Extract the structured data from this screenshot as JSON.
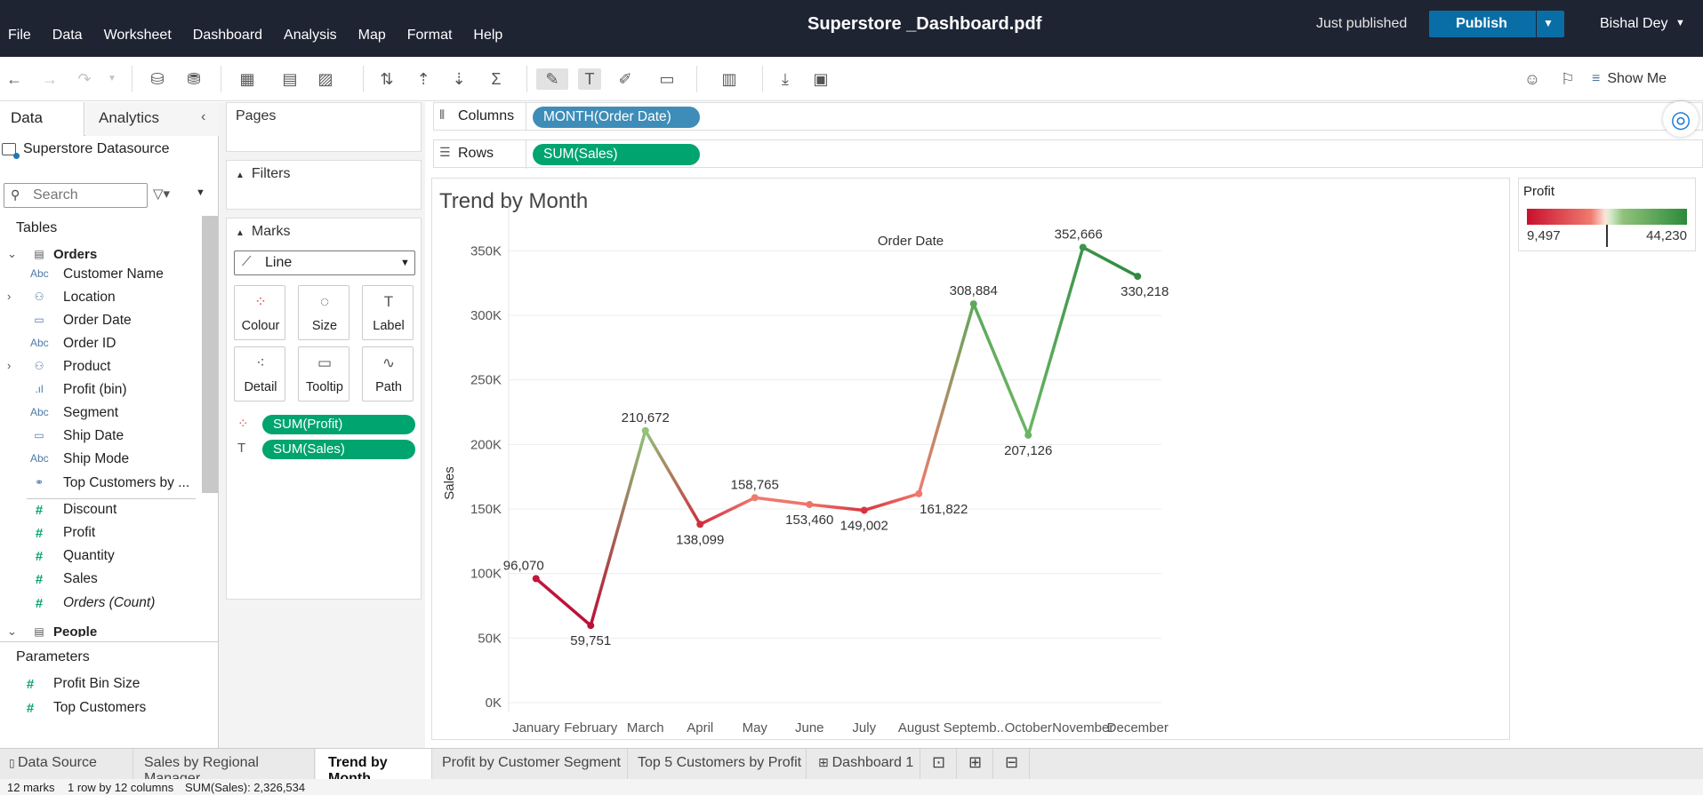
{
  "menu": [
    "File",
    "Data",
    "Worksheet",
    "Dashboard",
    "Analysis",
    "Map",
    "Format",
    "Help"
  ],
  "window_title": "Superstore _Dashboard.pdf",
  "publish_status": "Just published",
  "publish_label": "Publish",
  "user_name": "Bishal Dey",
  "show_me_label": "Show Me",
  "data_pane": {
    "tab_data": "Data",
    "tab_analytics": "Analytics",
    "datasource": "Superstore Datasource",
    "search_placeholder": "Search",
    "tables_heading": "Tables",
    "table_name": "Orders",
    "dimensions": [
      {
        "name": "Customer Name",
        "icon": "Abc"
      },
      {
        "name": "Location",
        "icon": "hierarchy-icon"
      },
      {
        "name": "Order Date",
        "icon": "calendar-icon"
      },
      {
        "name": "Order ID",
        "icon": "Abc"
      },
      {
        "name": "Product",
        "icon": "hierarchy-icon"
      },
      {
        "name": "Profit (bin)",
        "icon": "bin-icon"
      },
      {
        "name": "Segment",
        "icon": "Abc"
      },
      {
        "name": "Ship Date",
        "icon": "calendar-icon"
      },
      {
        "name": "Ship Mode",
        "icon": "Abc"
      },
      {
        "name": "Top Customers by ...",
        "icon": "set-icon"
      }
    ],
    "measures": [
      "Discount",
      "Profit",
      "Quantity",
      "Sales",
      "Orders (Count)"
    ],
    "next_table": "People",
    "parameters_heading": "Parameters",
    "parameters": [
      "Profit Bin Size",
      "Top Customers"
    ]
  },
  "cards": {
    "pages": "Pages",
    "filters": "Filters",
    "marks": "Marks",
    "mark_type": "Line",
    "mark_buttons": [
      "Colour",
      "Size",
      "Label",
      "Detail",
      "Tooltip",
      "Path"
    ],
    "mark_pills": [
      "SUM(Profit)",
      "SUM(Sales)"
    ]
  },
  "shelves": {
    "columns_label": "Columns",
    "columns_pill": "MONTH(Order Date)",
    "rows_label": "Rows",
    "rows_pill": "SUM(Sales)"
  },
  "legend": {
    "title": "Profit",
    "min": "9,497",
    "max": "44,230"
  },
  "chart_data": {
    "type": "line",
    "title": "Trend by Month",
    "xlabel": "Order Date",
    "ylabel": "Sales",
    "categories": [
      "January",
      "February",
      "March",
      "April",
      "May",
      "June",
      "July",
      "August",
      "Septemb..",
      "October",
      "November",
      "December"
    ],
    "values": [
      96070,
      59751,
      210672,
      138099,
      158765,
      153460,
      149002,
      161822,
      308884,
      207126,
      352666,
      330218
    ],
    "value_labels": [
      "96,070",
      "59,751",
      "210,672",
      "138,099",
      "158,765",
      "153,460",
      "149,002",
      "161,822",
      "308,884",
      "207,126",
      "352,666",
      "330,218"
    ],
    "colors": [
      "#c5153c",
      "#bb0f35",
      "#8fc27a",
      "#cf2f3f",
      "#f07a6e",
      "#ee7466",
      "#d8343f",
      "#f07a6e",
      "#5fa85a",
      "#6cb565",
      "#3d944a",
      "#2f8a3f"
    ],
    "yticks": [
      "0K",
      "50K",
      "100K",
      "150K",
      "200K",
      "250K",
      "300K",
      "350K"
    ],
    "ylim": [
      0,
      375000
    ],
    "grid": true
  },
  "sheet_tabs": [
    "Data Source",
    "Sales by Regional Manager",
    "Trend by Month",
    "Profit by Customer Segment",
    "Top 5 Customers by Profit",
    "Dashboard 1"
  ],
  "status": {
    "marks": "12 marks",
    "dims": "1 row by 12 columns",
    "sum": "SUM(Sales): 2,326,534"
  }
}
